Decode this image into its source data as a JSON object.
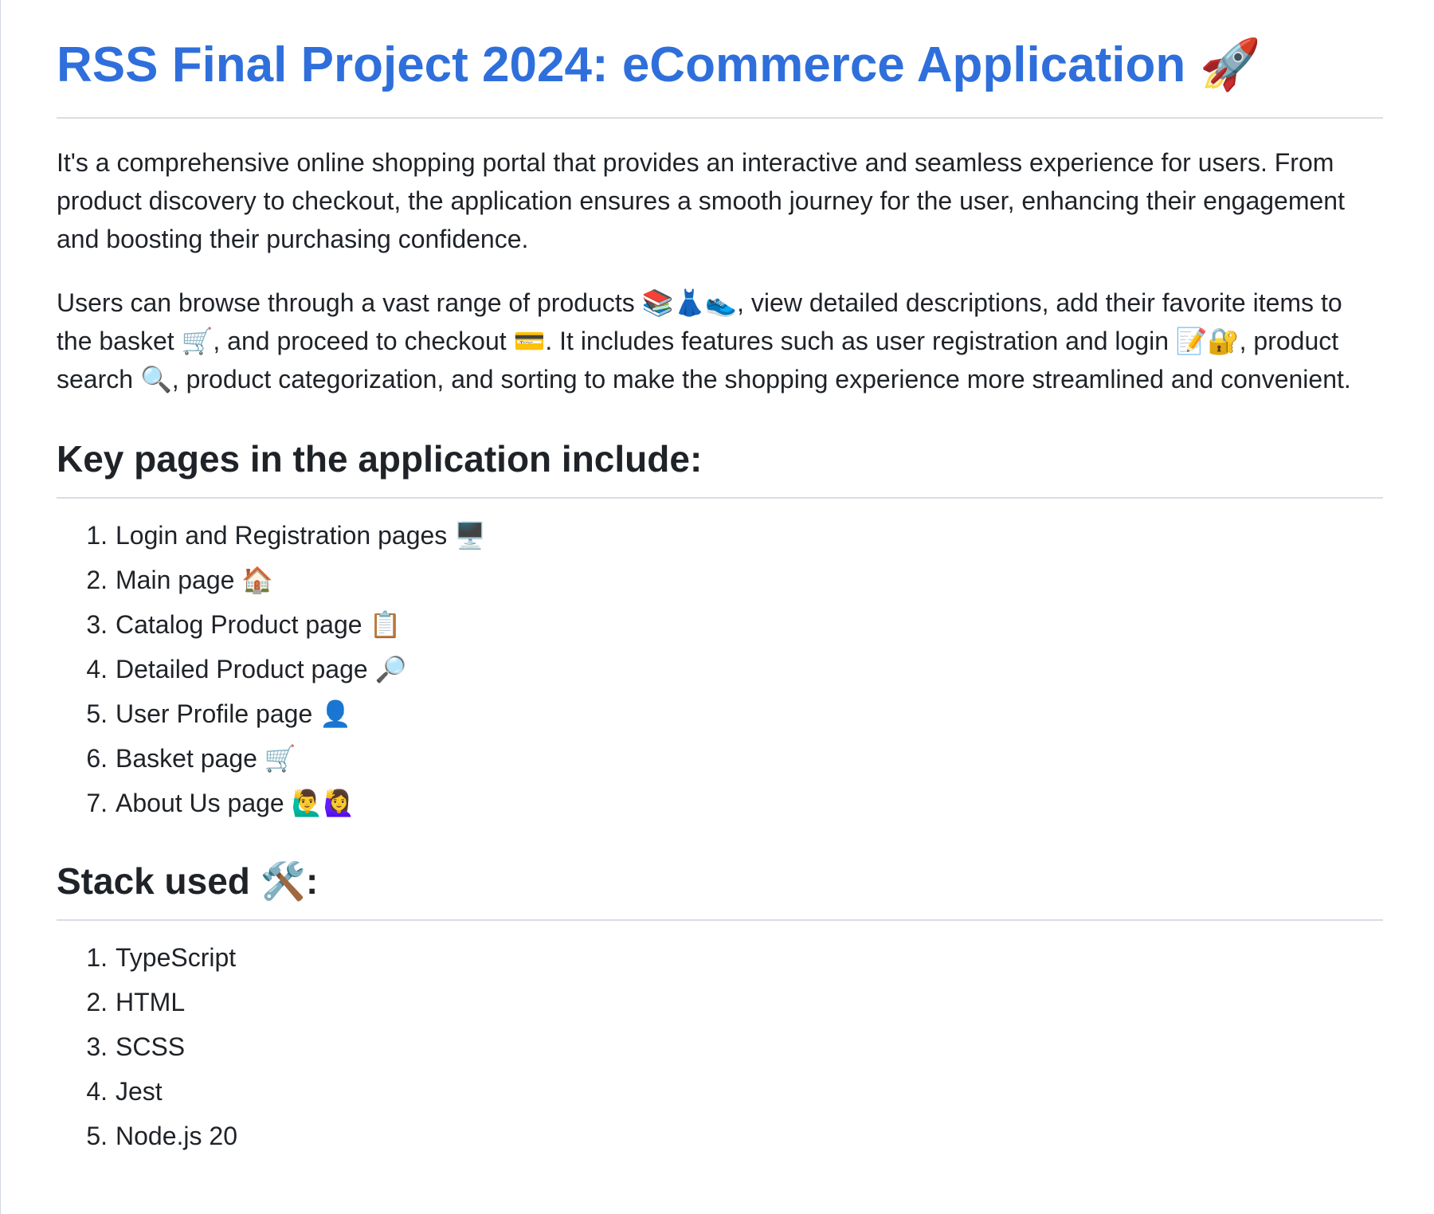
{
  "title": "RSS Final Project 2024: eCommerce Application",
  "title_emoji": "🚀",
  "intro_paragraph": "It's a comprehensive online shopping portal that provides an interactive and seamless experience for users. From product discovery to checkout, the application ensures a smooth journey for the user, enhancing their engagement and boosting their purchasing confidence.",
  "features_paragraph": "Users can browse through a vast range of products 📚👗👟, view detailed descriptions, add their favorite items to the basket 🛒, and proceed to checkout 💳. It includes features such as user registration and login 📝🔐, product search 🔍, product categorization, and sorting to make the shopping experience more streamlined and convenient.",
  "key_pages": {
    "heading": "Key pages in the application include:",
    "items": [
      {
        "number": "1.",
        "label": "Login and Registration pages 🖥️"
      },
      {
        "number": "2.",
        "label": "Main page 🏠"
      },
      {
        "number": "3.",
        "label": "Catalog Product page 📋"
      },
      {
        "number": "4.",
        "label": "Detailed Product page 🔎"
      },
      {
        "number": "5.",
        "label": "User Profile page 👤"
      },
      {
        "number": "6.",
        "label": "Basket page 🛒"
      },
      {
        "number": "7.",
        "label": "About Us page 🙋‍♂️🙋‍♀️"
      }
    ]
  },
  "stack": {
    "heading": "Stack used 🛠️:",
    "items": [
      {
        "number": "1.",
        "label": "TypeScript"
      },
      {
        "number": "2.",
        "label": "HTML"
      },
      {
        "number": "3.",
        "label": "SCSS"
      },
      {
        "number": "4.",
        "label": "Jest"
      },
      {
        "number": "5.",
        "label": "Node.js 20"
      }
    ]
  },
  "colors": {
    "title_link": "#2f6fdb",
    "text": "#1f2328",
    "divider": "#d8dee4"
  }
}
